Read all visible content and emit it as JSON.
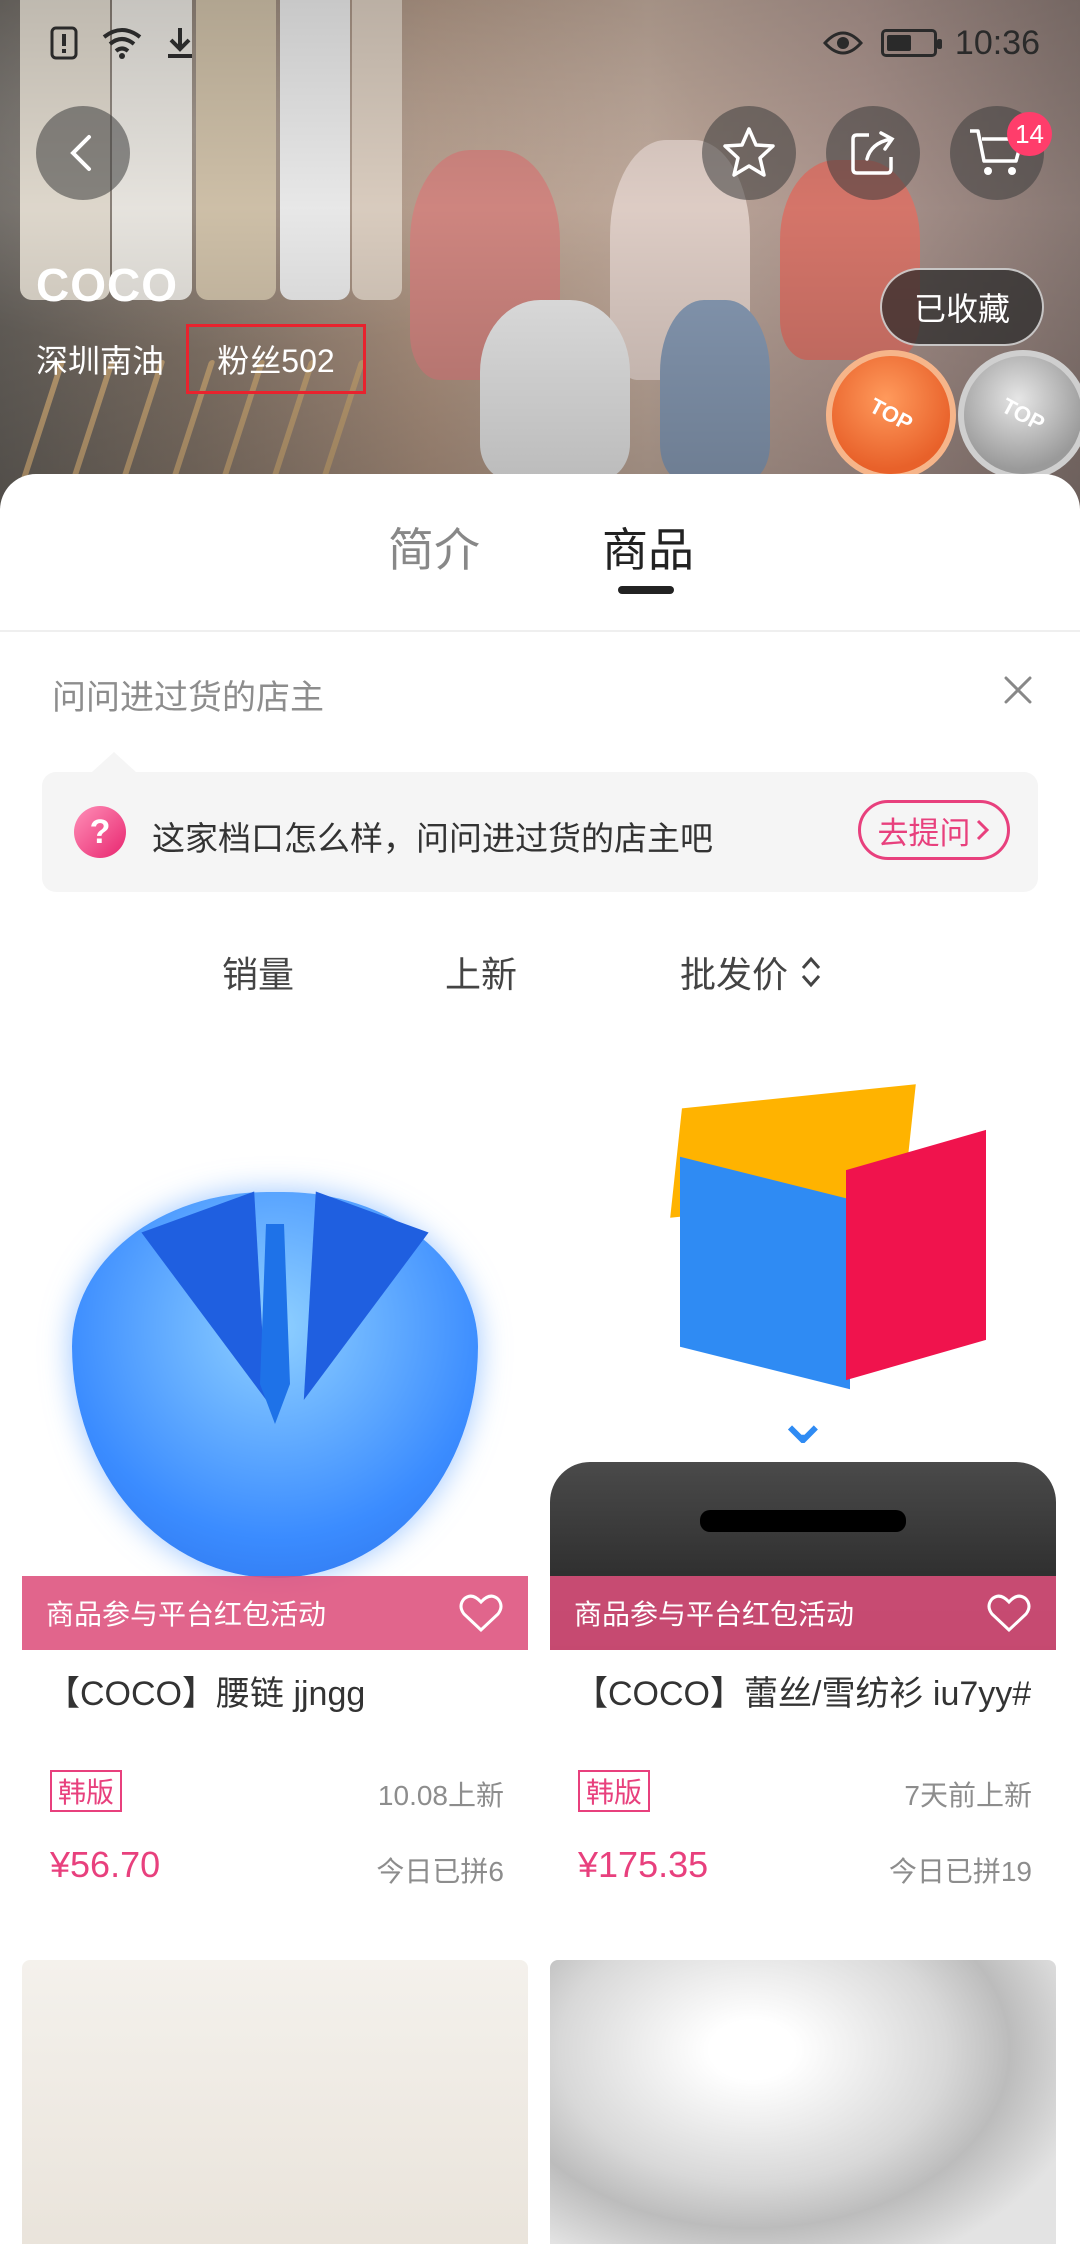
{
  "status_bar": {
    "time": "10:36",
    "battery_level": 0.55
  },
  "header": {
    "shop_name": "COCO",
    "location": "深圳南油",
    "fans_label": "粉丝502",
    "collected_label": "已收藏",
    "cart_badge": "14"
  },
  "tabs": [
    {
      "label": "简介"
    },
    {
      "label": "商品"
    }
  ],
  "ask": {
    "title": "问问进过货的店主",
    "prompt": "这家档口怎么样，问问进过货的店主吧",
    "button": "去提问"
  },
  "sort": {
    "sales": "销量",
    "new": "上新",
    "price": "批发价"
  },
  "products": [
    {
      "promo": "商品参与平台红包活动",
      "title": "【COCO】腰链 jjngg",
      "tag": "韩版",
      "new_time": "10.08上新",
      "price": "¥56.70",
      "sold": "今日已拼6"
    },
    {
      "promo": "商品参与平台红包活动",
      "title": "【COCO】蕾丝/雪纺衫 iu7yy#",
      "tag": "韩版",
      "new_time": "7天前上新",
      "price": "¥175.35",
      "sold": "今日已拼19"
    }
  ],
  "colors": {
    "accent_pink": "#e8407d",
    "highlight_red": "#e8232e",
    "promo_bg": "#dd507c"
  }
}
